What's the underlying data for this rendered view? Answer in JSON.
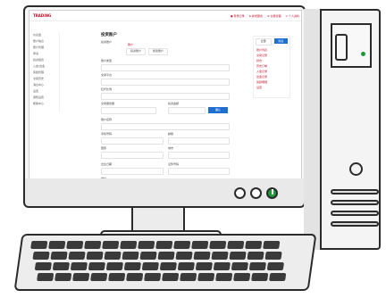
{
  "brand": {
    "logo": "TRADING"
  },
  "topnav": [
    "● 登录记录",
    "⊕ 新增服务",
    "⊕ 交易管理",
    "⊙ 个人资料"
  ],
  "sidebar": [
    "仪表盘",
    "账户信息",
    "账户管理",
    "申请",
    "投资组合",
    "入金/出金",
    "奖励管理",
    "交易历史",
    "消息中心",
    "设置",
    "通知设置",
    "帮助中心"
  ],
  "main": {
    "page_title": "投资账户",
    "section_title": "投资账户",
    "tab_label": "账户",
    "buttons": [
      "投资账户",
      "新建账户"
    ],
    "fields": [
      "账户类型",
      "交易平台",
      "杠杆比例",
      "交易服务器",
      "投资金额",
      "账户名称",
      "手机号码",
      "邮箱",
      "国家",
      "城市",
      "出生日期",
      "证件号码",
      "地址",
      "备注",
      "邮政编码"
    ],
    "confirm_button": "确认"
  },
  "right_panel": {
    "tabs": [
      "全部",
      "筛选"
    ],
    "items": [
      "账户列表",
      "交易记录",
      "持仓",
      "历史订单",
      "入金记录",
      "出金记录",
      "奖励明细",
      "设置"
    ]
  },
  "colors": {
    "accent": "#c0102a",
    "primary": "#1f6fd1",
    "power": "#1e9a3a"
  }
}
